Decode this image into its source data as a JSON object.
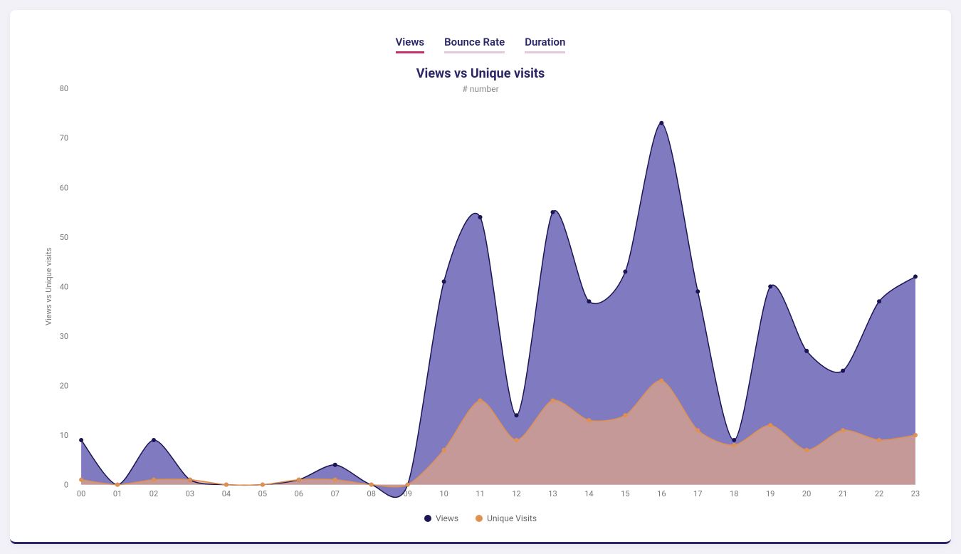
{
  "tabs": {
    "views": "Views",
    "bounce": "Bounce Rate",
    "duration": "Duration",
    "active": "views"
  },
  "chart": {
    "title": "Views vs Unique visits",
    "subtitle": "# number",
    "ylabel": "Views vs Unique visits"
  },
  "legend": {
    "views": "Views",
    "unique": "Unique Visits"
  },
  "colors": {
    "views_fill": "#6a63b6",
    "views_stroke": "#1c1554",
    "unique_fill": "#dca489",
    "unique_stroke": "#e0914f",
    "views_dot": "#1c1554",
    "unique_dot": "#e0914f"
  },
  "chart_data": {
    "type": "area",
    "categories": [
      "00",
      "01",
      "02",
      "03",
      "04",
      "05",
      "06",
      "07",
      "08",
      "09",
      "10",
      "11",
      "12",
      "13",
      "14",
      "15",
      "16",
      "17",
      "18",
      "19",
      "20",
      "21",
      "22",
      "23"
    ],
    "series": [
      {
        "name": "Views",
        "values": [
          9,
          0,
          9,
          1,
          0,
          0,
          1,
          4,
          0,
          0,
          41,
          54,
          14,
          55,
          37,
          43,
          73,
          39,
          9,
          40,
          27,
          23,
          37,
          42
        ]
      },
      {
        "name": "Unique Visits",
        "values": [
          1,
          0,
          1,
          1,
          0,
          0,
          1,
          1,
          0,
          0,
          7,
          17,
          9,
          17,
          13,
          14,
          21,
          11,
          8,
          12,
          7,
          11,
          9,
          10
        ]
      }
    ],
    "title": "Views vs Unique visits",
    "subtitle": "# number",
    "xlabel": "",
    "ylabel": "Views vs Unique visits",
    "ylim": [
      0,
      80
    ],
    "yticks": [
      0,
      10,
      20,
      30,
      40,
      50,
      60,
      70,
      80
    ],
    "legend_position": "bottom",
    "grid": false
  }
}
